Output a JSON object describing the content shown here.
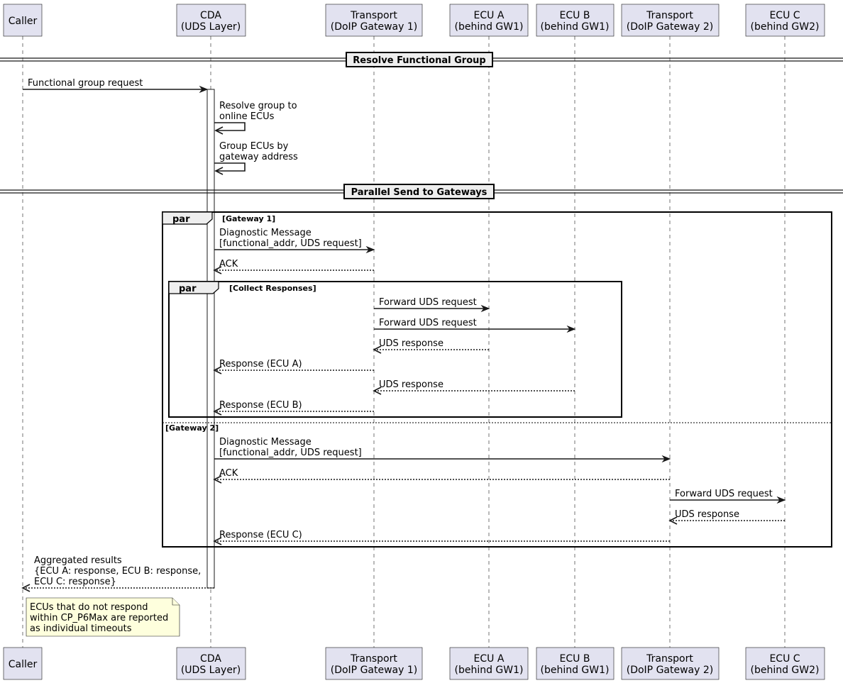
{
  "participants": [
    {
      "id": "caller",
      "lines": [
        "Caller"
      ]
    },
    {
      "id": "cda",
      "lines": [
        "CDA",
        "(UDS Layer)"
      ]
    },
    {
      "id": "gw1",
      "lines": [
        "Transport",
        "(DoIP Gateway 1)"
      ]
    },
    {
      "id": "ecua",
      "lines": [
        "ECU A",
        "(behind GW1)"
      ]
    },
    {
      "id": "ecub",
      "lines": [
        "ECU B",
        "(behind GW1)"
      ]
    },
    {
      "id": "gw2",
      "lines": [
        "Transport",
        "(DoIP Gateway 2)"
      ]
    },
    {
      "id": "ecuc",
      "lines": [
        "ECU C",
        "(behind GW2)"
      ]
    }
  ],
  "separators": [
    {
      "label": "Resolve Functional Group"
    },
    {
      "label": "Parallel Send to Gateways"
    }
  ],
  "fragments": [
    {
      "keyword": "par",
      "condition": "[Gateway 1]",
      "else_condition": "[Gateway 2]"
    },
    {
      "keyword": "par",
      "condition": "[Collect Responses]"
    }
  ],
  "messages": [
    {
      "from": "caller",
      "to": "cda",
      "style": "solid",
      "lines": [
        "Functional group request"
      ]
    },
    {
      "from": "cda",
      "to": "cda",
      "style": "solid",
      "lines": [
        "Resolve group to",
        "online ECUs"
      ]
    },
    {
      "from": "cda",
      "to": "cda",
      "style": "solid",
      "lines": [
        "Group ECUs by",
        "gateway address"
      ]
    },
    {
      "from": "cda",
      "to": "gw1",
      "style": "solid",
      "lines": [
        "Diagnostic Message",
        "[functional_addr, UDS request]"
      ]
    },
    {
      "from": "gw1",
      "to": "cda",
      "style": "dotted",
      "lines": [
        "ACK"
      ]
    },
    {
      "from": "gw1",
      "to": "ecua",
      "style": "solid",
      "lines": [
        "Forward UDS request"
      ]
    },
    {
      "from": "gw1",
      "to": "ecub",
      "style": "solid",
      "lines": [
        "Forward UDS request"
      ]
    },
    {
      "from": "ecua",
      "to": "gw1",
      "style": "dotted",
      "lines": [
        "UDS response"
      ]
    },
    {
      "from": "gw1",
      "to": "cda",
      "style": "dotted",
      "lines": [
        "Response (ECU A)"
      ]
    },
    {
      "from": "ecub",
      "to": "gw1",
      "style": "dotted",
      "lines": [
        "UDS response"
      ]
    },
    {
      "from": "gw1",
      "to": "cda",
      "style": "dotted",
      "lines": [
        "Response (ECU B)"
      ]
    },
    {
      "from": "cda",
      "to": "gw2",
      "style": "solid",
      "lines": [
        "Diagnostic Message",
        "[functional_addr, UDS request]"
      ]
    },
    {
      "from": "gw2",
      "to": "cda",
      "style": "dotted",
      "lines": [
        "ACK"
      ]
    },
    {
      "from": "gw2",
      "to": "ecuc",
      "style": "solid",
      "lines": [
        "Forward UDS request"
      ]
    },
    {
      "from": "ecuc",
      "to": "gw2",
      "style": "dotted",
      "lines": [
        "UDS response"
      ]
    },
    {
      "from": "gw2",
      "to": "cda",
      "style": "dotted",
      "lines": [
        "Response (ECU C)"
      ]
    },
    {
      "from": "cda",
      "to": "caller",
      "style": "dotted",
      "lines": [
        "Aggregated results",
        "{ECU A: response, ECU B: response,",
        "ECU C: response}"
      ]
    }
  ],
  "note": {
    "lines": [
      "ECUs that do not respond",
      "within CP_P6Max are reported",
      "as individual timeouts"
    ]
  },
  "colors": {
    "participant_fill": "#E2E2F0",
    "note_fill": "#FEFFDD",
    "separator_fill": "#EEEEEE",
    "line": "#181818"
  }
}
